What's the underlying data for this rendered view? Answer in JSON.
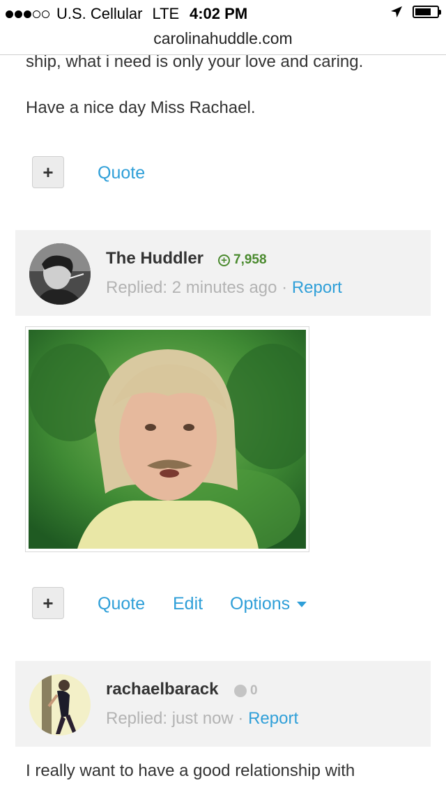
{
  "status_bar": {
    "carrier": "U.S. Cellular",
    "network": "LTE",
    "time": "4:02 PM",
    "signal_filled": 3,
    "signal_total": 5
  },
  "browser": {
    "url": "carolinahuddle.com"
  },
  "previous_post": {
    "text_line1": "ship, what i need is only your love and caring.",
    "text_line2": "Have a nice day Miss Rachael.",
    "plus_label": "+",
    "quote_label": "Quote"
  },
  "post_huddler": {
    "username": "The Huddler",
    "reputation": "7,958",
    "reputation_icon": "plus-circle-icon",
    "reputation_color": "#4a8a2e",
    "meta_prefix": "Replied: 2 minutes ago",
    "separator": " · ",
    "report_label": "Report",
    "image_description_icon": "gif-image",
    "plus_label": "+",
    "quote_label": "Quote",
    "edit_label": "Edit",
    "options_label": "Options"
  },
  "post_rachael": {
    "username": "rachaelbarack",
    "reputation": "0",
    "reputation_color": "#bbbbbb",
    "meta_prefix": "Replied: just now",
    "separator": " · ",
    "report_label": "Report",
    "text_line1": "I really want to have a good relationship with"
  },
  "colors": {
    "link": "#2f9fd8",
    "header_bg": "#f2f2f2",
    "muted": "#b3b3b3"
  }
}
